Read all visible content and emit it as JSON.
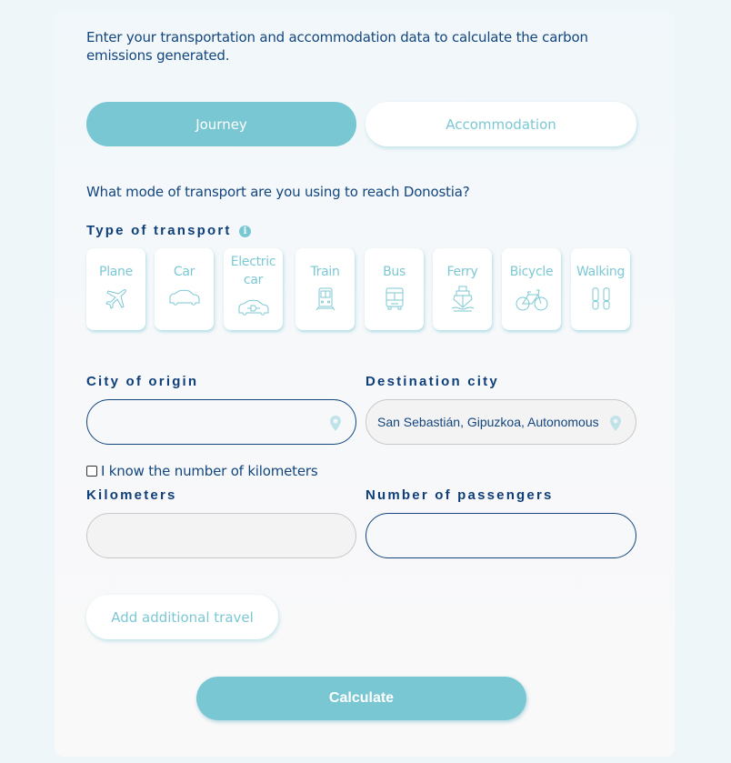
{
  "intro": "Enter your transportation and accommodation data to calculate the carbon emissions generated.",
  "tabs": [
    {
      "label": "Journey",
      "active": true
    },
    {
      "label": "Accommodation",
      "active": false
    }
  ],
  "question": "What mode of transport are you using to reach Donostia?",
  "transport": {
    "label": "Type of transport",
    "info_icon": "info-icon",
    "modes": [
      {
        "label": "Plane",
        "icon": "plane-icon"
      },
      {
        "label": "Car",
        "icon": "car-icon"
      },
      {
        "label": "Electric car",
        "icon": "electric-car-icon"
      },
      {
        "label": "Train",
        "icon": "train-icon"
      },
      {
        "label": "Bus",
        "icon": "bus-icon"
      },
      {
        "label": "Ferry",
        "icon": "ferry-icon"
      },
      {
        "label": "Bicycle",
        "icon": "bicycle-icon"
      },
      {
        "label": "Walking",
        "icon": "footprints-icon"
      }
    ]
  },
  "origin": {
    "label": "City of origin",
    "value": "",
    "placeholder": ""
  },
  "destination": {
    "label": "Destination city",
    "value": "San Sebastián, Gipuzkoa, Autonomous"
  },
  "know_km": {
    "label": "I know the number of kilometers",
    "checked": false
  },
  "kilometers": {
    "label": "Kilometers",
    "value": ""
  },
  "passengers": {
    "label": "Number of passengers",
    "value": ""
  },
  "add_travel_label": "Add additional travel",
  "calculate_label": "Calculate",
  "colors": {
    "accent": "#7ac7d4",
    "text": "#13467f",
    "card_bg": "#f6f8fa"
  }
}
